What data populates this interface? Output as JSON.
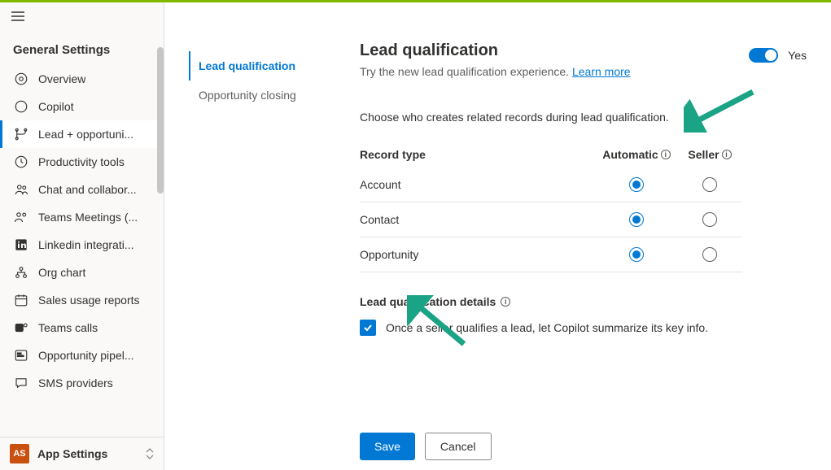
{
  "sidebar": {
    "title": "General Settings",
    "items": [
      {
        "icon": "eye",
        "label": "Overview"
      },
      {
        "icon": "copilot",
        "label": "Copilot"
      },
      {
        "icon": "branch",
        "label": "Lead + opportuni..."
      },
      {
        "icon": "clock",
        "label": "Productivity tools"
      },
      {
        "icon": "people",
        "label": "Chat and collabor..."
      },
      {
        "icon": "teams",
        "label": "Teams Meetings (..."
      },
      {
        "icon": "linkedin",
        "label": "Linkedin integrati..."
      },
      {
        "icon": "org",
        "label": "Org chart"
      },
      {
        "icon": "calendar",
        "label": "Sales usage reports"
      },
      {
        "icon": "teams-logo",
        "label": "Teams calls"
      },
      {
        "icon": "pipeline",
        "label": "Opportunity pipel..."
      },
      {
        "icon": "chat",
        "label": "SMS providers"
      }
    ],
    "footer": {
      "badge": "AS",
      "label": "App Settings"
    }
  },
  "subnav": {
    "items": [
      {
        "label": "Lead qualification",
        "active": true
      },
      {
        "label": "Opportunity closing",
        "active": false
      }
    ]
  },
  "main": {
    "title": "Lead qualification",
    "subtitle_prefix": "Try the new lead qualification experience. ",
    "subtitle_link": "Learn more",
    "toggle_label": "Yes",
    "intro": "Choose who creates related records during lead qualification.",
    "columns": {
      "c1": "Record type",
      "c2": "Automatic",
      "c3": "Seller"
    },
    "rows": [
      {
        "label": "Account",
        "auto": true
      },
      {
        "label": "Contact",
        "auto": true
      },
      {
        "label": "Opportunity",
        "auto": true
      }
    ],
    "details_title": "Lead qualification details",
    "checkbox_label": "Once a seller qualifies a lead, let Copilot summarize its key info.",
    "save": "Save",
    "cancel": "Cancel"
  }
}
